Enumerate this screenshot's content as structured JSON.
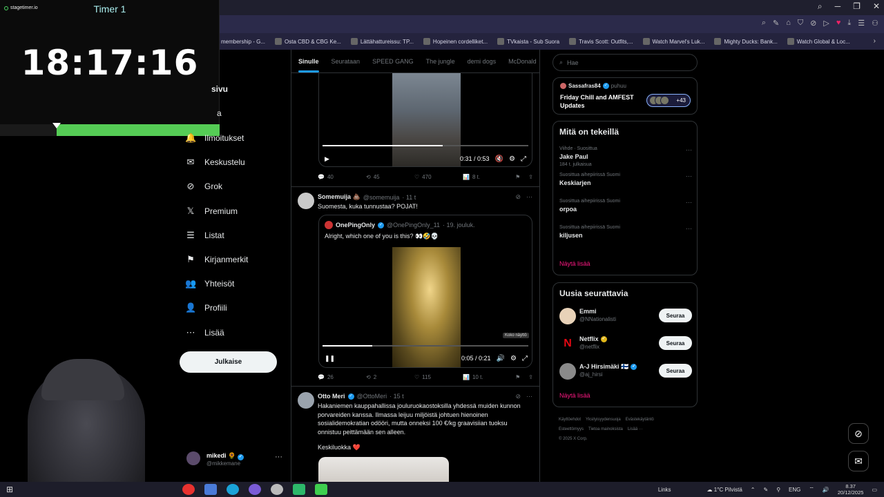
{
  "timer": {
    "brand": "stagetimer.io",
    "name": "Timer 1",
    "time": "18:17:16",
    "progress_fraction": 0.74
  },
  "browser": {
    "bookmarks": [
      "membership - G...",
      "Osta CBD & CBG Ke...",
      "Lättähattureissu: TP...",
      "Hopeinen cordelliket...",
      "TVkaista - Sub Suora",
      "Travis Scott: Outfits,...",
      "Watch Marvel's Luk...",
      "Mighty Ducks: Bank...",
      "Watch Global & Loc..."
    ]
  },
  "nav": {
    "partial_home": "sivu",
    "partial_explore": "a",
    "items": [
      {
        "label": "Ilmoitukset",
        "icon": "bell-icon",
        "glyph": "🔔"
      },
      {
        "label": "Keskustelu",
        "icon": "mail-icon",
        "glyph": "✉"
      },
      {
        "label": "Grok",
        "icon": "grok-icon",
        "glyph": "⊘"
      },
      {
        "label": "Premium",
        "icon": "x-logo-icon",
        "glyph": "𝕏"
      },
      {
        "label": "Listat",
        "icon": "list-icon",
        "glyph": "☰"
      },
      {
        "label": "Kirjanmerkit",
        "icon": "bookmark-icon",
        "glyph": "⚑"
      },
      {
        "label": "Yhteisöt",
        "icon": "communities-icon",
        "glyph": "👥"
      },
      {
        "label": "Profiili",
        "icon": "profile-icon",
        "glyph": "👤"
      },
      {
        "label": "Lisää",
        "icon": "more-circle-icon",
        "glyph": "⋯"
      }
    ],
    "post_button": "Julkaise",
    "profile": {
      "name": "mikedi",
      "handle": "@mikkemane"
    }
  },
  "feed": {
    "tabs": [
      "Sinulle",
      "Seurataan",
      "SPEED GANG",
      "The jungle",
      "demi dogs",
      "McDonald"
    ],
    "active_tab": 0,
    "post1": {
      "video": {
        "time": "0:31 / 0:53",
        "progress": 0.585
      },
      "stats": {
        "replies": "40",
        "reposts": "45",
        "likes": "470",
        "views": "8 t."
      }
    },
    "post2": {
      "name": "Somemuija 💩",
      "handle": "@somemuija",
      "age": "· 11 t",
      "text": "Suomesta, kuka tunnustaa? POJAT!",
      "quote": {
        "name": "OnePingOnly",
        "handle": "@OnePingOnly_11",
        "age": "· 19. jouluk.",
        "text": "Alright, which one of you is this? 👀🤣💀",
        "tooltip": "Koko näyttö",
        "video_time": "0:05 / 0:21",
        "video_progress": 0.24
      },
      "stats": {
        "replies": "26",
        "reposts": "2",
        "likes": "115",
        "views": "10 t."
      }
    },
    "post3": {
      "name": "Otto Meri",
      "handle": "@OttoMeri",
      "age": "· 15 t",
      "text": "Hakaniemen kauppahallissa jouluruokaostoksilla yhdessä muiden kunnon porvareiden kanssa. Ilmassa leijuu miljöistä johtuen hienoinen sosialidemokratian odööri, mutta onneksi 100 €/kg graavisiian tuoksu onnistuu peittämään sen alleen.",
      "text2": "Keskiluokka ❤️"
    }
  },
  "sidebar": {
    "search_placeholder": "Hae",
    "space": {
      "host": "Sassafras84",
      "status": "puhuu",
      "title": "Friday Chill and AMFEST Updates",
      "count": "+43"
    },
    "trends_title": "Mitä on tekeillä",
    "trends": [
      {
        "meta": "Viihde · Suosittua",
        "title": "Jake Paul",
        "count": "184 t. julkaisua"
      },
      {
        "meta": "Suosittua aihepiirissä Suomi",
        "title": "Keskiarjen",
        "count": ""
      },
      {
        "meta": "Suosittua aihepiirissä Suomi",
        "title": "orpoa",
        "count": ""
      },
      {
        "meta": "Suosittua aihepiirissä Suomi",
        "title": "kiljusen",
        "count": ""
      }
    ],
    "show_more": "Näytä lisää",
    "follow_title": "Uusia seurattavia",
    "follow": [
      {
        "name": "Emmi",
        "handle": "@NNationalisti",
        "badge": "",
        "button": "Seuraa",
        "color": "#e8d2b8"
      },
      {
        "name": "Netflix",
        "handle": "@netflix",
        "badge": "gold",
        "button": "Seuraa",
        "color": "#000000"
      },
      {
        "name": "A-J Hirsimäki 🇫🇮",
        "handle": "@aj_hirsi",
        "badge": "blue",
        "button": "Seuraa",
        "color": "#8a8a8a"
      }
    ],
    "show_more2": "Näytä lisää",
    "footer": [
      "Käyttöehdot",
      "Yksityisyydensuoja",
      "Evästekäytäntö",
      "Esteettömyys",
      "Tietoa mainoksista",
      "Lisää ···",
      "© 2025 X Corp."
    ]
  },
  "taskbar": {
    "links": "Links",
    "weather": "1°C Pilvistä",
    "lang": "ENG",
    "time": "8.37",
    "date": "20/12/2025"
  }
}
